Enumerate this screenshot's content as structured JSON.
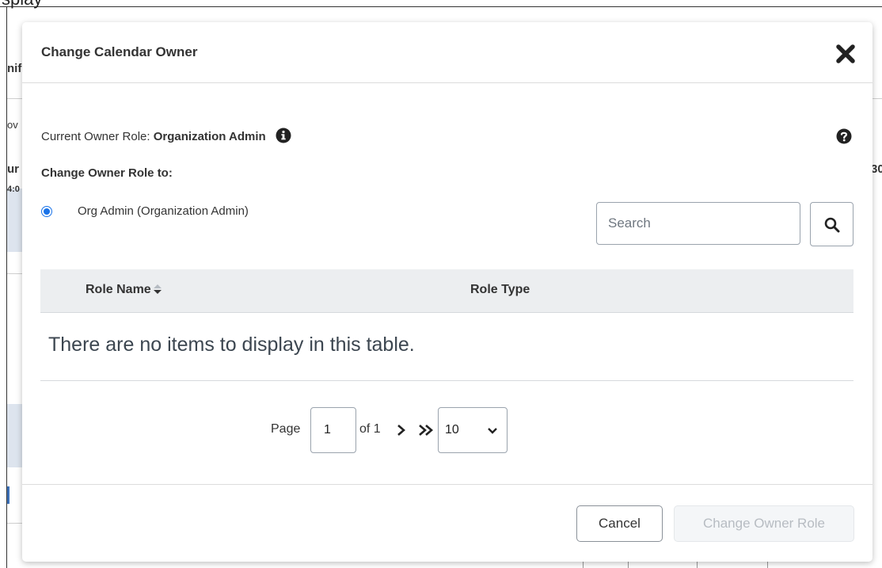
{
  "background": {
    "top_label": "splay",
    "fragments": [
      "nif",
      "ov",
      "ur",
      "4:0",
      "30"
    ]
  },
  "dialog": {
    "title": "Change Calendar Owner",
    "current_owner_prefix": "Current Owner Role:",
    "current_owner_value": "Organization Admin",
    "change_to_label": "Change Owner Role to:",
    "selected_option": "Org Admin (Organization Admin)",
    "search": {
      "placeholder": "Search",
      "value": ""
    },
    "table": {
      "columns": [
        "Role Name",
        "Role Type"
      ],
      "empty_message": "There are no items to display in this table.",
      "rows": []
    },
    "pagination": {
      "page_label": "Page",
      "current_page": "1",
      "of_label": "of 1",
      "page_size": "10"
    },
    "buttons": {
      "cancel": "Cancel",
      "submit": "Change Owner Role"
    }
  },
  "colors": {
    "accent": "#1a73e8",
    "header_bg": "#eceef0",
    "disabled_text": "#b7bcc2"
  }
}
